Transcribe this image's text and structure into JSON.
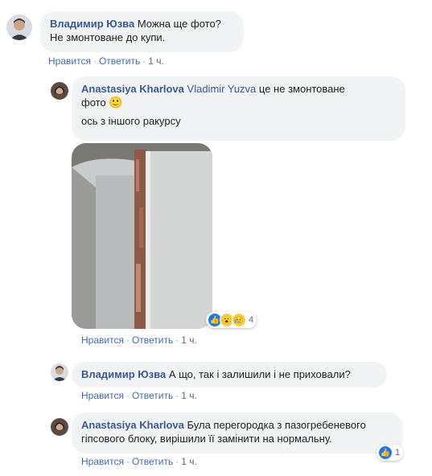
{
  "comments": [
    {
      "author": "Владимир Юзва",
      "text_line1": "Можна ще фото?",
      "text_line2": "Не змонтоване до купи.",
      "actions": {
        "like": "Нравится",
        "reply": "Ответить",
        "time": "1 ч."
      }
    },
    {
      "author": "Anastasiya Kharlova",
      "mention": "Vladimir Yuzva",
      "text_line1_rest": "це не змонтоване",
      "text_line2": "фото",
      "emoji": "🙂",
      "text_line3": "ось з іншого ракурсу",
      "reaction_count": "4",
      "actions": {
        "like": "Нравится",
        "reply": "Ответить",
        "time": "1 ч."
      }
    },
    {
      "author": "Владимир Юзва",
      "text": "А що, так і залишили і не приховали?",
      "actions": {
        "like": "Нравится",
        "reply": "Ответить",
        "time": "1 ч."
      }
    },
    {
      "author": "Anastasiya Kharlova",
      "text_line1": "Була перегородка з пазогребеневого",
      "text_line2": "гіпсового блоку, вирішили її замінити на нормальну.",
      "reaction_count": "1",
      "actions": {
        "like": "Нравится",
        "reply": "Ответить",
        "time": "1 ч."
      }
    }
  ],
  "colors": {
    "link": "#385898",
    "bubble": "#f2f3f5",
    "like_blue": "#1877f2"
  }
}
